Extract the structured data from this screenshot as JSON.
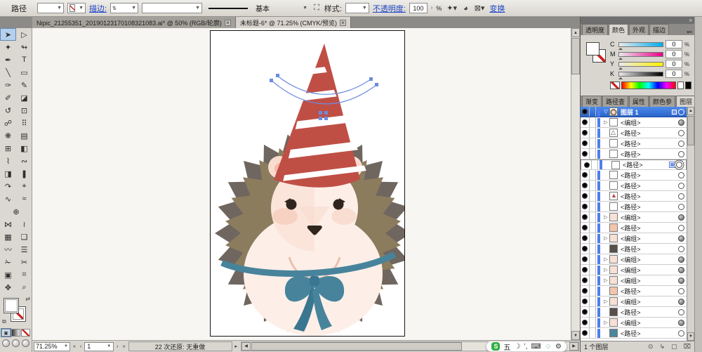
{
  "control_bar": {
    "path_label": "路径",
    "stroke_link": "描边:",
    "line_style_value": "基本",
    "style_label": "样式:",
    "opacity_link": "不透明度:",
    "opacity_value": "100",
    "percent": "%",
    "transform_link": "变换"
  },
  "tabs": [
    {
      "label": "Nipic_21255351_20190123170108321083.ai* @ 50% (RGB/轮廓)",
      "close": "×"
    },
    {
      "label": "未标题-6* @ 71.25% (CMYK/预览)",
      "close": "×"
    }
  ],
  "tools": [
    {
      "name": "selection-tool",
      "glyph": "➤",
      "cls": "active"
    },
    {
      "name": "direct-selection-tool",
      "glyph": "▷"
    },
    {
      "name": "magic-wand-tool",
      "glyph": "✦"
    },
    {
      "name": "lasso-tool",
      "glyph": "↬"
    },
    {
      "name": "pen-tool",
      "glyph": "✒"
    },
    {
      "name": "type-tool",
      "glyph": "T"
    },
    {
      "name": "line-tool",
      "glyph": "╲"
    },
    {
      "name": "rectangle-tool",
      "glyph": "▭"
    },
    {
      "name": "paintbrush-tool",
      "glyph": "✑"
    },
    {
      "name": "pencil-tool",
      "glyph": "✎"
    },
    {
      "name": "smooth-tool",
      "glyph": "✐"
    },
    {
      "name": "eraser-tool",
      "glyph": "◪"
    },
    {
      "name": "rotate-tool",
      "glyph": "↺"
    },
    {
      "name": "scale-tool",
      "glyph": "⊡"
    },
    {
      "name": "warp-tool",
      "glyph": "☍"
    },
    {
      "name": "free-transform-tool",
      "glyph": "⠿"
    },
    {
      "name": "symbol-sprayer-tool",
      "glyph": "❋"
    },
    {
      "name": "graph-tool",
      "glyph": "▤"
    },
    {
      "name": "mesh-tool",
      "glyph": "⊞"
    },
    {
      "name": "gradient-tool",
      "glyph": "◧"
    },
    {
      "name": "eyedropper-tool",
      "glyph": "⌇"
    },
    {
      "name": "blend-tool",
      "glyph": "∾"
    },
    {
      "name": "live-paint-bucket-tool",
      "glyph": "◨"
    },
    {
      "name": "column-graph-tool",
      "glyph": "❚"
    },
    {
      "name": "reshape-tool",
      "glyph": "↷"
    },
    {
      "name": "crystallize-tool",
      "glyph": "⌖"
    },
    {
      "name": "wave-tool",
      "glyph": "∿"
    },
    {
      "name": "scribble-tool",
      "glyph": "≈"
    },
    {
      "name": "artboard-tool",
      "glyph": "⊕",
      "cls": "span2"
    },
    {
      "name": "envelope-tool",
      "glyph": "⋈"
    },
    {
      "name": "distort-tool",
      "glyph": "≀"
    },
    {
      "name": "mesh-grid-tool",
      "glyph": "▦"
    },
    {
      "name": "page-tool",
      "glyph": "❏"
    },
    {
      "name": "wrinkle-tool",
      "glyph": "〰"
    },
    {
      "name": "flatten-tool",
      "glyph": "☰"
    },
    {
      "name": "knife-tool",
      "glyph": "✁"
    },
    {
      "name": "scissors-tool",
      "glyph": "✂"
    },
    {
      "name": "crop-tool",
      "glyph": "▣"
    },
    {
      "name": "slice-tool",
      "glyph": "⌗"
    },
    {
      "name": "hand-tool",
      "glyph": "✥"
    },
    {
      "name": "zoom-tool",
      "glyph": "⌕"
    }
  ],
  "artwork": {
    "subject": "hedgehog wearing red striped party hat with teal ribbon bow; curved path selected over hat",
    "colors": {
      "spikes_outer": "#6f6660",
      "spikes_inner": "#8c7c5e",
      "body": "#fdefe8",
      "shade": "#f8d9cc",
      "blush": "#f6cdbd",
      "ear": "#fadccf",
      "ear_inner": "#f3bba9",
      "eye": "#30261f",
      "hat": "#bf4f45",
      "stripe": "#ffffff",
      "ribbon": "#47849b",
      "ribbon_dark": "#3a7690",
      "selection": "#6c8ce0"
    }
  },
  "status_bar": {
    "zoom": "71.25%",
    "nav_first": "«",
    "nav_prev": "‹",
    "page": "1",
    "nav_next": "›",
    "nav_last": "»",
    "undo_status": "22 次还原: 无重做",
    "status_arrow": "▸"
  },
  "ime_bar": {
    "logo": "S",
    "mode": "五",
    "moon": "☽",
    "punct": "’,",
    "keyboard": "⌨",
    "person": "☺",
    "wrench": "⚙"
  },
  "panels": {
    "dock_collapse": "»",
    "menu_icon": "▾≡",
    "color_panel": {
      "tabs": [
        "透明度",
        "颜色",
        "外观",
        "描边"
      ],
      "sliders": [
        {
          "label": "C",
          "value": "0",
          "cls": "grad-c"
        },
        {
          "label": "M",
          "value": "0",
          "cls": "grad-m"
        },
        {
          "label": "Y",
          "value": "0",
          "cls": "grad-y"
        },
        {
          "label": "K",
          "value": "0",
          "cls": "grad-k"
        }
      ],
      "percent": "%"
    },
    "layers_panel": {
      "tabs": [
        "渐变",
        "路径查",
        "属性",
        "颜色参",
        "图层"
      ],
      "layer_name": "图层 1",
      "expand_arrow": "▽",
      "rows": [
        {
          "arrow": "▷",
          "thumb": "",
          "label": "<编组>",
          "target": "ball"
        },
        {
          "thumb": "t-tri",
          "label": "<路径>",
          "target": "ring"
        },
        {
          "thumb": "",
          "label": "<路径>",
          "target": "ring"
        },
        {
          "thumb": "",
          "label": "<路径>",
          "target": "ring"
        },
        {
          "thumb": "",
          "label": "<路径>",
          "target": "sel"
        },
        {
          "thumb": "",
          "label": "<路径>",
          "target": "ring"
        },
        {
          "thumb": "",
          "label": "<路径>",
          "target": "ring"
        },
        {
          "thumb": "t-red",
          "label": "<路径>",
          "target": "ring"
        },
        {
          "thumb": "",
          "label": "<路径>",
          "target": "ring"
        },
        {
          "arrow": "▷",
          "thumb": "t-pink",
          "label": "<编组>",
          "target": "ball"
        },
        {
          "thumb": "t-peach",
          "label": "<路径>",
          "target": "ring"
        },
        {
          "arrow": "▷",
          "thumb": "t-pink",
          "label": "<编组>",
          "target": "ball"
        },
        {
          "thumb": "t-dark",
          "label": "<路径>",
          "target": "ring"
        },
        {
          "arrow": "▷",
          "thumb": "t-pink",
          "label": "<编组>",
          "target": "ball"
        },
        {
          "arrow": "▷",
          "thumb": "t-pink",
          "label": "<编组>",
          "target": "ball"
        },
        {
          "arrow": "▷",
          "thumb": "t-pink",
          "label": "<编组>",
          "target": "ball"
        },
        {
          "thumb": "t-peach",
          "label": "<路径>",
          "target": "ring"
        },
        {
          "arrow": "▷",
          "thumb": "t-pink",
          "label": "<编组>",
          "target": "ball"
        },
        {
          "thumb": "t-dark",
          "label": "<路径>",
          "target": "ring"
        },
        {
          "arrow": "▷",
          "thumb": "t-pink",
          "label": "<编组>",
          "target": "ball"
        },
        {
          "thumb": "t-teal",
          "label": "<路径>",
          "target": "ring"
        }
      ],
      "footer": "1 个图层",
      "footer_icons": {
        "clip_mask": "⊙",
        "new_sublayer": "↳",
        "new_layer": "▢",
        "delete": "⌧"
      }
    }
  }
}
